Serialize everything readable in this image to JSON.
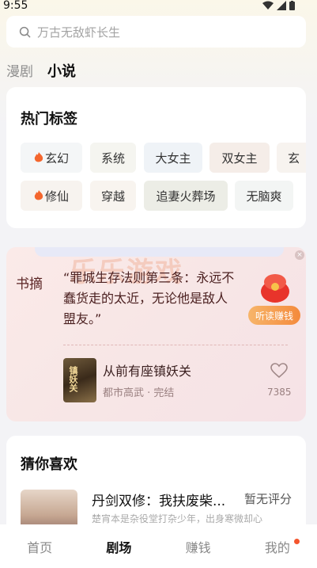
{
  "status_bar": {
    "time": "9:55"
  },
  "search": {
    "placeholder": "万古无敌虾长生"
  },
  "top_tabs": [
    {
      "label": "漫剧",
      "active": false
    },
    {
      "label": "小说",
      "active": true
    }
  ],
  "hot_tags": {
    "title": "热门标签",
    "rows": [
      [
        {
          "label": "玄幻",
          "hot": true
        },
        {
          "label": "系统",
          "hot": false
        },
        {
          "label": "大女主",
          "hot": false
        },
        {
          "label": "双女主",
          "hot": false
        },
        {
          "label": "玄",
          "hot": false
        }
      ],
      [
        {
          "label": "修仙",
          "hot": true
        },
        {
          "label": "穿越",
          "hot": false
        },
        {
          "label": "追妻火葬场",
          "hot": false
        },
        {
          "label": "无脑爽",
          "hot": false
        }
      ]
    ]
  },
  "excerpt": {
    "label": "书摘",
    "watermark": "乐乐游戏",
    "quote_lines": [
      "“罪城生存法则第三条：永远不",
      "蠢货走的太近，无论他是敌人",
      "盟友。”"
    ],
    "listen_button": "听读赚钱",
    "close_icon": "close-icon",
    "book": {
      "cover_text": "镇妖关",
      "title": "从前有座镇妖关",
      "meta": "都市高武 · 完结",
      "likes": "7385"
    }
  },
  "guess": {
    "title": "猜你喜欢",
    "item": {
      "title": "丹剑双修：我扶废柴...",
      "score": "暂无评分",
      "desc": "楚宵本是杂役堂打杂少年，出身寒微却心"
    }
  },
  "bottom_nav": [
    {
      "label": "首页",
      "active": false,
      "dot": false
    },
    {
      "label": "剧场",
      "active": true,
      "dot": false
    },
    {
      "label": "赚钱",
      "active": false,
      "dot": false
    },
    {
      "label": "我的",
      "active": false,
      "dot": true
    }
  ],
  "colors": {
    "accent": "#f48a3c",
    "fire": "#f4662d",
    "dot": "#f4552d"
  }
}
